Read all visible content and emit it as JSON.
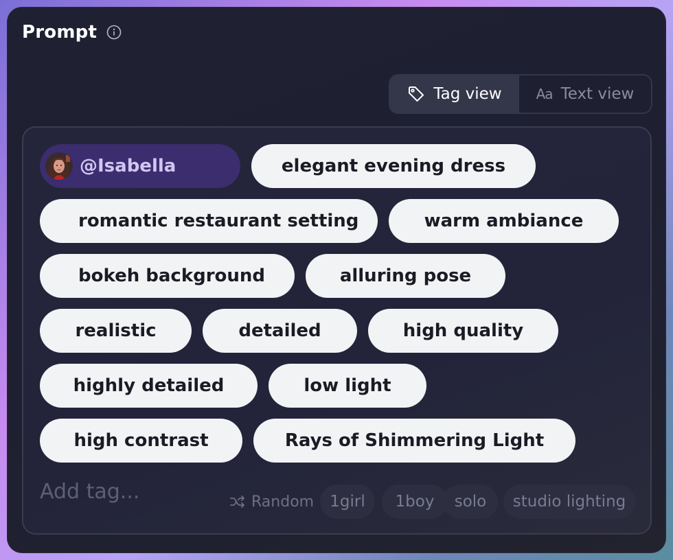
{
  "header": {
    "title": "Prompt",
    "info_icon": "info-circle-icon"
  },
  "view_toggle": {
    "tag_view_label": "Tag view",
    "text_view_label": "Text view",
    "text_view_icon": "Aa",
    "selected": "Tag view"
  },
  "mention": {
    "label": "@Isabella",
    "avatar": "avatar-isabella"
  },
  "tags": [
    "elegant evening dress",
    "romantic restaurant setting",
    "warm ambiance",
    "bokeh background",
    "alluring pose",
    "realistic",
    "detailed",
    "high quality",
    "highly detailed",
    "low light",
    "high contrast",
    "Rays of Shimmering Light"
  ],
  "input": {
    "placeholder": "Add tag..."
  },
  "suggestions": {
    "random_label": "Random",
    "items": [
      "1girl",
      "1boy",
      "solo",
      "studio lighting"
    ]
  },
  "colors": {
    "panel_bg": "#1f2032",
    "tag_bg": "#f2f3f5",
    "mention_bg": "#3b2d6e",
    "suggestion_bg": "#2d2e40"
  }
}
